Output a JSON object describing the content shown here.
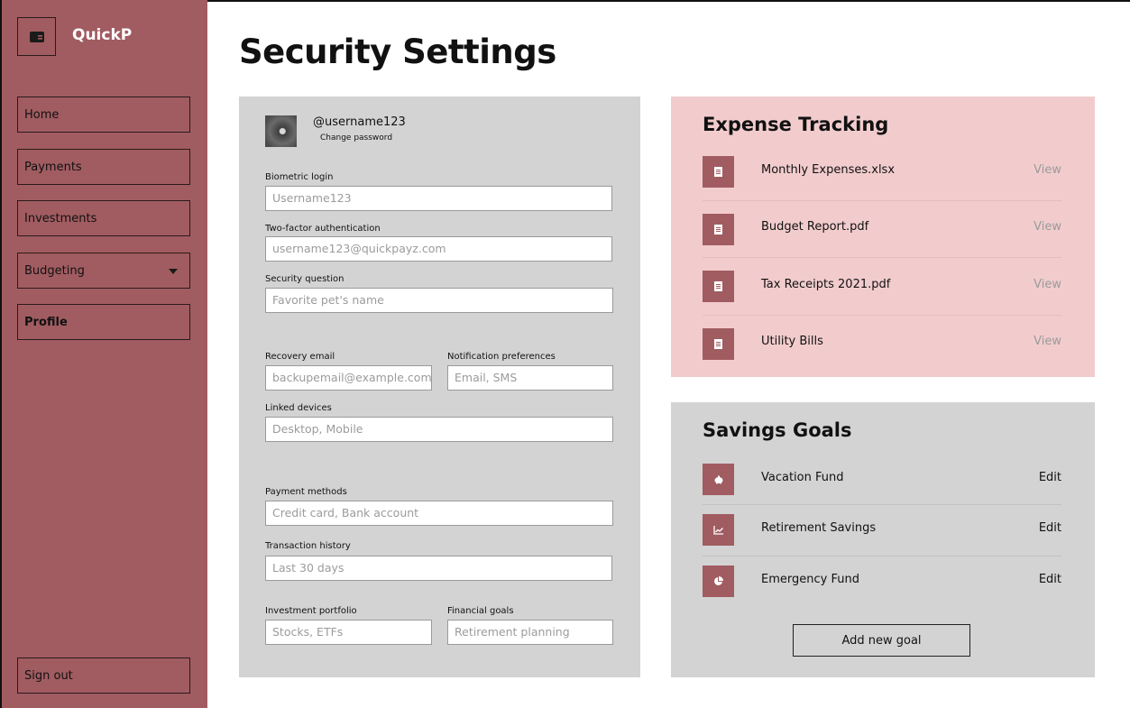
{
  "app": {
    "name": "QuickP"
  },
  "sidebar": {
    "items": [
      {
        "label": "Home"
      },
      {
        "label": "Payments"
      },
      {
        "label": "Investments"
      },
      {
        "label": "Budgeting"
      },
      {
        "label": "Profile"
      }
    ],
    "sign_out": "Sign out"
  },
  "page": {
    "title": "Security Settings"
  },
  "profile": {
    "username": "@username123",
    "change_password": "Change password"
  },
  "fields": {
    "biometric": {
      "label": "Biometric login",
      "placeholder": "Username123"
    },
    "two_factor": {
      "label": "Two-factor authentication",
      "placeholder": "username123@quickpayz.com"
    },
    "security_question": {
      "label": "Security question",
      "placeholder": "Favorite pet's name"
    },
    "recovery_email": {
      "label": "Recovery email",
      "placeholder": "backupemail@example.com"
    },
    "notification_prefs": {
      "label": "Notification preferences",
      "placeholder": "Email, SMS"
    },
    "linked_devices": {
      "label": "Linked devices",
      "placeholder": "Desktop, Mobile"
    },
    "payment_methods": {
      "label": "Payment methods",
      "placeholder": "Credit card, Bank account"
    },
    "transaction_history": {
      "label": "Transaction history",
      "placeholder": "Last 30 days"
    },
    "investment_portfolio": {
      "label": "Investment portfolio",
      "placeholder": "Stocks, ETFs"
    },
    "financial_goals": {
      "label": "Financial goals",
      "placeholder": "Retirement planning"
    }
  },
  "expense": {
    "title": "Expense Tracking",
    "items": [
      {
        "name": "Monthly Expenses.xlsx",
        "action": "View",
        "icon": "document-icon"
      },
      {
        "name": "Budget Report.pdf",
        "action": "View",
        "icon": "document-icon"
      },
      {
        "name": "Tax Receipts 2021.pdf",
        "action": "View",
        "icon": "document-icon"
      },
      {
        "name": "Utility Bills",
        "action": "View",
        "icon": "document-icon"
      }
    ]
  },
  "savings": {
    "title": "Savings Goals",
    "items": [
      {
        "name": "Vacation Fund",
        "action": "Edit",
        "icon": "piggy-bank-icon"
      },
      {
        "name": "Retirement Savings",
        "action": "Edit",
        "icon": "line-chart-icon"
      },
      {
        "name": "Emergency Fund",
        "action": "Edit",
        "icon": "pie-chart-icon"
      }
    ],
    "add_button": "Add new goal"
  },
  "colors": {
    "sidebar": "#a15c61",
    "panel_gray": "#d3d3d3",
    "panel_pink": "#f2cccd",
    "accent": "#a15c61"
  }
}
